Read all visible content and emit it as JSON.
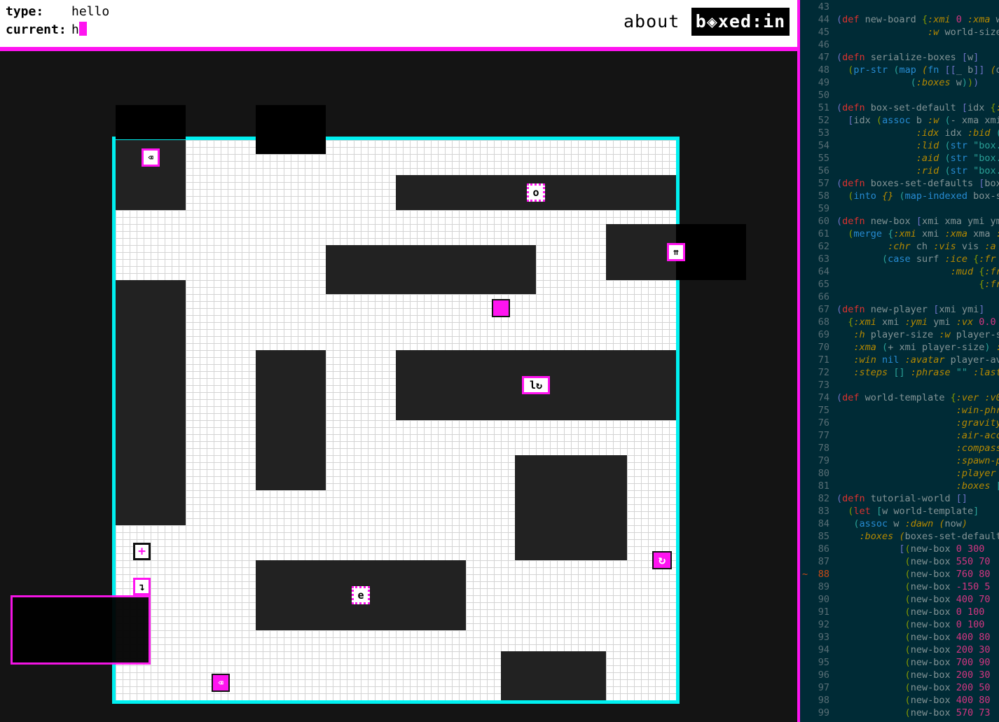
{
  "header": {
    "type_label": "type:",
    "type_value": "hello",
    "current_label": "current:",
    "current_value": "h",
    "about_label": "about",
    "logo_text": "b◈xed:in"
  },
  "colors": {
    "accent": "#ff14f0",
    "field_border": "#00f0f0",
    "wall": "#222222",
    "code_bg": "#002b36"
  },
  "board": {
    "tiles": [
      {
        "name": "backspace-icon-tile",
        "icon": "backspace-icon",
        "char": "⌫"
      },
      {
        "name": "letter-tile-o",
        "icon": "letter-o",
        "char": "o"
      },
      {
        "name": "arrows-up-icon-tile",
        "icon": "double-up-arrow-icon",
        "char": "⇈"
      },
      {
        "name": "letter-rotate-tile-l",
        "icon": "letter-l-rotate",
        "char": "l↻"
      },
      {
        "name": "rotate-icon-tile",
        "icon": "rotate-icon",
        "char": "↻"
      },
      {
        "name": "plus-icon-tile",
        "icon": "plus-icon",
        "char": "+"
      },
      {
        "name": "down-arrow-icon-tile",
        "icon": "down-return-arrow-icon",
        "char": "↴"
      },
      {
        "name": "letter-tile-e",
        "icon": "letter-e",
        "char": "e"
      },
      {
        "name": "backspace-filled-tile",
        "icon": "backspace-icon",
        "char": "⌫"
      }
    ]
  },
  "code": {
    "current_line_marker": "~",
    "lines": [
      {
        "n": "43",
        "h": ""
      },
      {
        "n": "44",
        "h": "<span class='v'>(</span><span class='k'>def</span> new-board <span class='g'>{</span><span class='y'>:xmi</span> <span class='p'>0</span> <span class='y'>:xma</span> w"
      },
      {
        "n": "45",
        "h": "                <span class='y'>:w</span> world-size"
      },
      {
        "n": "46",
        "h": ""
      },
      {
        "n": "47",
        "h": "<span class='v'>(</span><span class='k'>defn</span> serialize-boxes <span class='v'>[</span>w<span class='v'>]</span>"
      },
      {
        "n": "48",
        "h": "  <span class='g'>(</span><span class='b'>pr-str</span> <span class='s'>(</span><span class='b'>map</span> <span class='y'>(</span><span class='b'>fn</span> <span class='v'>[[</span>_ b<span class='v'>]]</span> <span class='y'>(</span>d"
      },
      {
        "n": "49",
        "h": "             <span class='s'>(</span><span class='y'>:boxes</span> w<span class='s'>)</span><span class='g'>)</span><span class='v'>)</span>"
      },
      {
        "n": "50",
        "h": ""
      },
      {
        "n": "51",
        "h": "<span class='v'>(</span><span class='k'>defn</span> box-set-default <span class='v'>[</span>idx <span class='g'>{</span><span class='y'>:</span>"
      },
      {
        "n": "52",
        "h": "  <span class='v'>[</span>idx <span class='g'>(</span><span class='b'>assoc</span> b <span class='y'>:w</span> <span class='s'>(</span>- xma xmi"
      },
      {
        "n": "53",
        "h": "              <span class='y'>:idx</span> idx <span class='y'>:bid</span> <span class='s'>(</span>"
      },
      {
        "n": "54",
        "h": "              <span class='y'>:lid</span> <span class='s'>(</span><span class='b'>str</span> <span class='s'>\"box.</span>"
      },
      {
        "n": "55",
        "h": "              <span class='y'>:aid</span> <span class='s'>(</span><span class='b'>str</span> <span class='s'>\"box.</span>"
      },
      {
        "n": "56",
        "h": "              <span class='y'>:rid</span> <span class='s'>(</span><span class='b'>str</span> <span class='s'>\"box.</span>"
      },
      {
        "n": "57",
        "h": "<span class='v'>(</span><span class='k'>defn</span> boxes-set-defaults <span class='v'>[</span>box"
      },
      {
        "n": "58",
        "h": "  <span class='g'>(</span><span class='b'>into</span> <span class='y'>{}</span> <span class='s'>(</span><span class='b'>map-indexed</span> box-s"
      },
      {
        "n": "59",
        "h": ""
      },
      {
        "n": "60",
        "h": "<span class='v'>(</span><span class='k'>defn</span> new-box <span class='v'>[</span>xmi xma ymi ym"
      },
      {
        "n": "61",
        "h": "  <span class='g'>(</span><span class='b'>merge</span> <span class='s'>{</span><span class='y'>:xmi</span> xmi <span class='y'>:xma</span> xma <span class='y'>:</span>"
      },
      {
        "n": "62",
        "h": "         <span class='y'>:chr</span> ch <span class='y'>:vis</span> vis <span class='y'>:a</span>"
      },
      {
        "n": "63",
        "h": "        <span class='s'>(</span><span class='b'>case</span> surf <span class='y'>:ice</span> <span class='g'>{</span><span class='y'>:fr</span>"
      },
      {
        "n": "64",
        "h": "                    <span class='y'>:mud</span> <span class='g'>{</span><span class='y'>:fr</span>"
      },
      {
        "n": "65",
        "h": "                         <span class='g'>{</span><span class='y'>:fr</span>"
      },
      {
        "n": "66",
        "h": ""
      },
      {
        "n": "67",
        "h": "<span class='v'>(</span><span class='k'>defn</span> new-player <span class='v'>[</span>xmi ymi<span class='v'>]</span>"
      },
      {
        "n": "68",
        "h": "  <span class='g'>{</span><span class='y'>:xmi</span> xmi <span class='y'>:ymi</span> ymi <span class='y'>:vx</span> <span class='p'>0.0</span>"
      },
      {
        "n": "69",
        "h": "   <span class='y'>:h</span> player-size <span class='y'>:w</span> player-s"
      },
      {
        "n": "70",
        "h": "   <span class='y'>:xma</span> <span class='s'>(</span>+ xmi player-size<span class='s'>)</span> <span class='y'>:</span>"
      },
      {
        "n": "71",
        "h": "   <span class='y'>:win</span> <span class='b'>nil</span> <span class='y'>:avatar</span> player-av"
      },
      {
        "n": "72",
        "h": "   <span class='y'>:steps</span> <span class='s'>[]</span> <span class='y'>:phrase</span> <span class='s'>\"\"</span> <span class='y'>:last</span>"
      },
      {
        "n": "73",
        "h": ""
      },
      {
        "n": "74",
        "h": "<span class='v'>(</span><span class='k'>def</span> world-template <span class='g'>{</span><span class='y'>:ver</span> <span class='y'>:v0</span>"
      },
      {
        "n": "75",
        "h": "                     <span class='y'>:win-phr</span>"
      },
      {
        "n": "76",
        "h": "                     <span class='y'>:gravity</span>"
      },
      {
        "n": "77",
        "h": "                     <span class='y'>:air-acc</span>"
      },
      {
        "n": "78",
        "h": "                     <span class='y'>:compass</span>"
      },
      {
        "n": "79",
        "h": "                     <span class='y'>:spawn-p</span>"
      },
      {
        "n": "80",
        "h": "                     <span class='y'>:player</span>"
      },
      {
        "n": "81",
        "h": "                     <span class='y'>:boxes</span> <span class='s'>[</span>"
      },
      {
        "n": "82",
        "h": "<span class='v'>(</span><span class='k'>defn</span> tutorial-world <span class='v'>[]</span>"
      },
      {
        "n": "83",
        "h": "  <span class='g'>(</span><span class='k'>let</span> <span class='s'>[</span>w world-template<span class='s'>]</span>"
      },
      {
        "n": "84",
        "h": "   <span class='s'>(</span><span class='b'>assoc</span> w <span class='y'>:dawn</span> <span class='y'>(</span>now<span class='y'>)</span>"
      },
      {
        "n": "85",
        "h": "    <span class='y'>:boxes</span> <span class='y'>(</span>boxes-set-default"
      },
      {
        "n": "86",
        "h": "           <span class='v'>[</span><span class='g'>(</span>new-box <span class='p'>0</span> <span class='p'>300</span>"
      },
      {
        "n": "87",
        "h": "            <span class='g'>(</span>new-box <span class='p'>550</span> <span class='p'>70</span>"
      },
      {
        "n": "88",
        "h": "            <span class='g'>(</span>new-box <span class='p'>760</span> <span class='p'>80</span>"
      },
      {
        "n": "89",
        "h": "            <span class='g'>(</span>new-box <span class='p'>-150</span> <span class='p'>5</span>"
      },
      {
        "n": "90",
        "h": "            <span class='g'>(</span>new-box <span class='p'>400</span> <span class='p'>70</span>"
      },
      {
        "n": "91",
        "h": "            <span class='g'>(</span>new-box <span class='p'>0</span> <span class='p'>100</span>"
      },
      {
        "n": "92",
        "h": "            <span class='g'>(</span>new-box <span class='p'>0</span> <span class='p'>100</span>"
      },
      {
        "n": "93",
        "h": "            <span class='g'>(</span>new-box <span class='p'>400</span> <span class='p'>80</span>"
      },
      {
        "n": "94",
        "h": "            <span class='g'>(</span>new-box <span class='p'>200</span> <span class='p'>30</span>"
      },
      {
        "n": "95",
        "h": "            <span class='g'>(</span>new-box <span class='p'>700</span> <span class='p'>90</span>"
      },
      {
        "n": "96",
        "h": "            <span class='g'>(</span>new-box <span class='p'>200</span> <span class='p'>30</span>"
      },
      {
        "n": "97",
        "h": "            <span class='g'>(</span>new-box <span class='p'>200</span> <span class='p'>50</span>"
      },
      {
        "n": "98",
        "h": "            <span class='g'>(</span>new-box <span class='p'>400</span> <span class='p'>80</span>"
      },
      {
        "n": "99",
        "h": "            <span class='g'>(</span>new-box <span class='p'>570</span> <span class='p'>73</span>"
      }
    ]
  }
}
